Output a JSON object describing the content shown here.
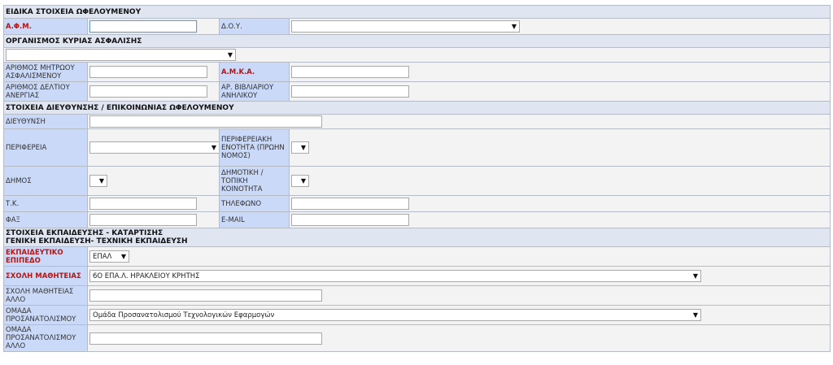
{
  "sections": {
    "beneficiary": "ΕΙΔΙΚΑ ΣΤΟΙΧΕΙΑ ΩΦΕΛΟΥΜΕΝΟΥ",
    "insurance": "ΟΡΓΑΝΙΣΜΟΣ ΚΥΡΙΑΣ ΑΣΦΑΛΙΣΗΣ",
    "address": "ΣΤΟΙΧΕΙΑ ΔΙΕΥΘΥΝΣΗΣ / ΕΠΙΚΟΙΝΩΝΙΑΣ ΩΦΕΛΟΥΜΕΝΟΥ",
    "education_1": "ΣΤΟΙΧΕΙΑ ΕΚΠΑΙΔΕΥΣΗΣ - ΚΑΤΑΡΤΙΣΗΣ",
    "education_2": "ΓΕΝΙΚΗ ΕΚΠΑΙΔΕΥΣΗ- ΤΕΧΝΙΚΗ ΕΚΠΑΙΔΕΥΣΗ"
  },
  "labels": {
    "afm": "Α.Φ.Μ.",
    "doy": "Δ.Ο.Υ.",
    "registry_number": "ΑΡΙΘΜΟΣ ΜΗΤΡΩΟΥ ΑΣΦΑΛΙΣΜΕΝΟΥ",
    "amka": "Α.Μ.Κ.Α.",
    "unemployment_card": "ΑΡΙΘΜΟΣ ΔΕΛΤΙΟΥ ΑΝΕΡΓΙΑΣ",
    "minor_book": "ΑΡ. ΒΙΒΛΙΑΡΙΟΥ ΑΝΗΛΙΚΟΥ",
    "address": "ΔΙΕΥΘΥΝΣΗ",
    "region": "ΠΕΡΙΦΕΡΕΙΑ",
    "regional_unit": "ΠΕΡΙΦΕΡΕΙΑΚΗ ΕΝΟΤΗΤΑ (ΠΡΩΗΝ ΝΟΜΟΣ)",
    "municipality": "ΔΗΜΟΣ",
    "community": "ΔΗΜΟΤΙΚΗ / ΤΟΠΙΚΗ ΚΟΙΝΟΤΗΤΑ",
    "postal_code": "Τ.Κ.",
    "phone": "ΤΗΛΕΦΩΝΟ",
    "fax": "ΦΑΞ",
    "email": "E-MAIL",
    "edu_level": "ΕΚΠΑΙΔΕΥΤΙΚΟ ΕΠΙΠΕΔΟ",
    "school": "ΣΧΟΛΗ ΜΑΘΗΤΕΙΑΣ",
    "school_other": "ΣΧΟΛΗ ΜΑΘΗΤΕΙΑΣ ΑΛΛΟ",
    "orientation_group": "ΟΜΑΔΑ ΠΡΟΣΑΝΑΤΟΛΙΣΜΟΥ",
    "orientation_group_other": "ΟΜΑΔΑ ΠΡΟΣΑΝΑΤΟΛΙΣΜΟΥ ΑΛΛΟ"
  },
  "values": {
    "edu_level": "ΕΠΑΛ",
    "school": "6Ο ΕΠΑ.Λ. ΗΡΑΚΛΕΙΟΥ ΚΡΗΤΗΣ",
    "orientation_group": "Ομάδα Προσανατολισμού Τεχνολογικών Εφαρμογών"
  },
  "icons": {
    "dropdown": "▼"
  },
  "colors": {
    "label_bg": "#c9d9f7",
    "section_bg": "#dfe5f1",
    "required_text": "#b01818"
  }
}
